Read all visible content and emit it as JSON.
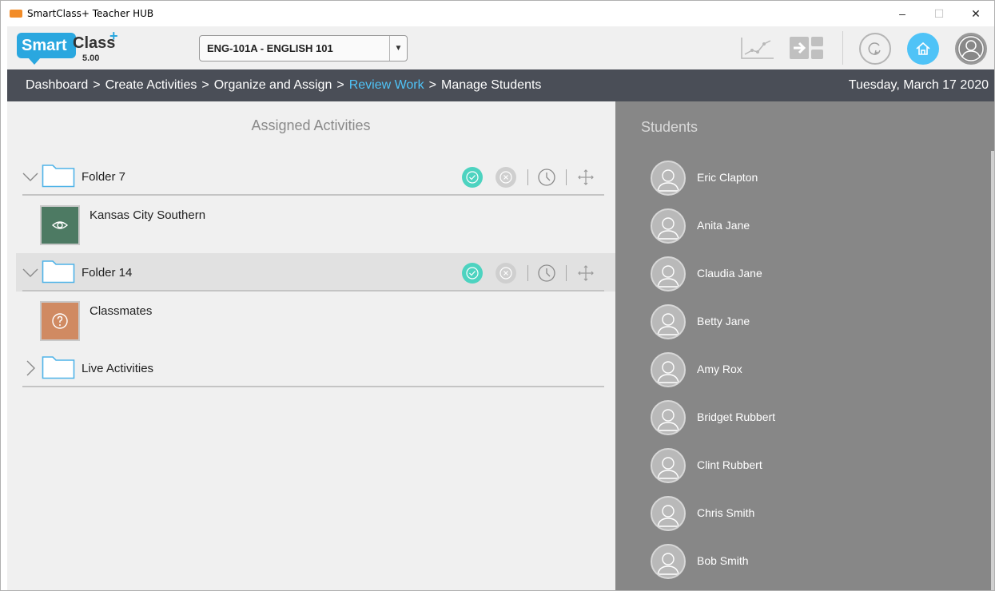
{
  "window": {
    "title": "SmartClass+ Teacher HUB",
    "minimize": "–",
    "maximize": "☐",
    "close": "✕"
  },
  "header": {
    "logo": {
      "brand1": "Smart",
      "brand2": "Class",
      "plus": "+",
      "version": "5.00"
    },
    "course": {
      "selected": "ENG-101A - ENGLISH 101",
      "arrow": "▼"
    },
    "icons": [
      "chart-icon",
      "assign-icon",
      "refresh-icon",
      "home-icon",
      "profile-icon"
    ],
    "accent": "#4fc3f7"
  },
  "nav": {
    "breadcrumbs": [
      "Dashboard",
      "Create Activities",
      "Organize and Assign",
      "Review Work",
      "Manage Students"
    ],
    "separator": ">",
    "active_index": 3,
    "date": "Tuesday, March 17 2020"
  },
  "assigned": {
    "title": "Assigned Activities",
    "folders": [
      {
        "name": "Folder 7",
        "expanded": true,
        "activities": [
          {
            "name": "Kansas City Southern",
            "icon": "eye-icon",
            "color": "#4d7a63"
          }
        ]
      },
      {
        "name": "Folder 14",
        "expanded": true,
        "highlight": true,
        "activities": [
          {
            "name": "Classmates",
            "icon": "question-icon",
            "color": "#d08a62"
          }
        ]
      },
      {
        "name": "Live Activities",
        "expanded": false,
        "activities": []
      }
    ]
  },
  "students": {
    "title": "Students",
    "list": [
      "Eric Clapton",
      "Anita Jane",
      "Claudia Jane",
      "Betty Jane",
      "Amy Rox",
      "Bridget Rubbert",
      "Clint Rubbert",
      "Chris Smith",
      "Bob Smith"
    ]
  }
}
